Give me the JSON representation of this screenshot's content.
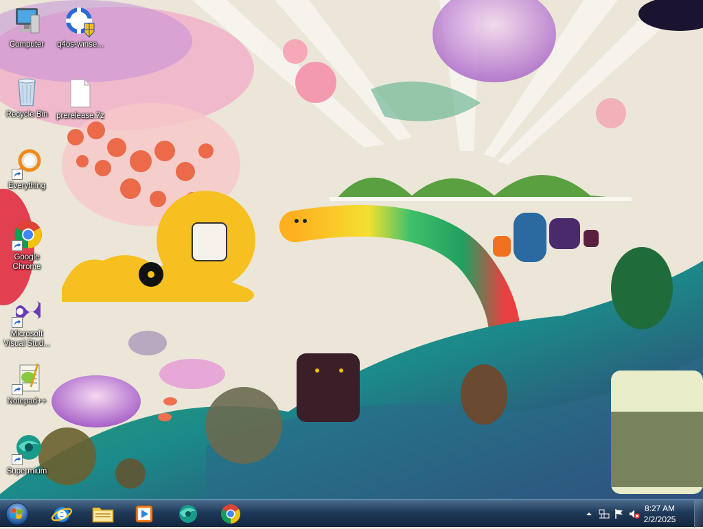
{
  "desktop": {
    "icons": [
      {
        "label": "Computer",
        "icon": "computer-icon"
      },
      {
        "label": "q4os-winse...",
        "icon": "shield-icon"
      },
      {
        "label": "Recycle Bin",
        "icon": "recycle-bin-icon"
      },
      {
        "label": "prerelease.7z",
        "icon": "file-icon"
      },
      {
        "label": "Everything",
        "icon": "everything-search-icon"
      },
      {
        "label": "Google Chrome",
        "icon": "chrome-icon"
      },
      {
        "label": "Microsoft Visual Stud...",
        "icon": "visual-studio-icon"
      },
      {
        "label": "Notepad++",
        "icon": "notepad-plus-plus-icon"
      },
      {
        "label": "Supermium",
        "icon": "supermium-icon"
      }
    ]
  },
  "taskbar": {
    "start": {
      "icon": "windows-logo-icon"
    },
    "pinned": [
      {
        "icon": "internet-explorer-icon"
      },
      {
        "icon": "file-explorer-icon"
      },
      {
        "icon": "media-player-icon"
      },
      {
        "icon": "supermium-icon"
      },
      {
        "icon": "chrome-icon"
      }
    ],
    "tray": {
      "icons": [
        "show-hidden-icons-chevron-icon",
        "network-icon",
        "action-center-flag-icon",
        "volume-muted-icon"
      ],
      "time": "8:27 AM",
      "date": "2/2/2025"
    }
  },
  "colors": {
    "taskbar_top": "#4a6a8c",
    "taskbar_bottom": "#13253d",
    "label_text": "#ffffff"
  }
}
